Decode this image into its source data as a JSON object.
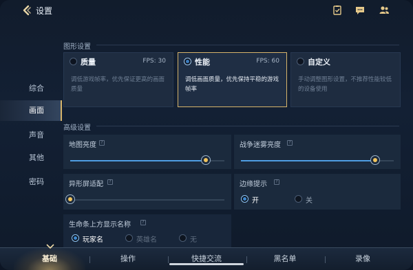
{
  "header": {
    "title": "设置"
  },
  "sections": {
    "graphics": "图形设置",
    "advanced": "高级设置"
  },
  "sidebar": {
    "items": [
      {
        "label": "综合"
      },
      {
        "label": "画面"
      },
      {
        "label": "声音"
      },
      {
        "label": "其他"
      },
      {
        "label": "密码"
      }
    ],
    "active": "画面"
  },
  "presets": [
    {
      "name": "质量",
      "fps": "FPS: 30",
      "desc": "调低游戏帧率，优先保证更高的画面质量",
      "selected": false
    },
    {
      "name": "性能",
      "fps": "FPS: 60",
      "desc": "调低画面质量，优先保持平稳的游戏帧率",
      "selected": true
    },
    {
      "name": "自定义",
      "fps": "",
      "desc": "手动调整图形设置，不推荐性能较低的设备使用",
      "selected": false
    }
  ],
  "advanced": {
    "map_brightness": {
      "label": "地图亮度",
      "value": 0.88
    },
    "fog_brightness": {
      "label": "战争迷雾亮度",
      "value": 0.88
    },
    "notch_adapt": {
      "label": "异形屏适配",
      "value": 0.0
    },
    "edge_hint": {
      "label": "边缘提示",
      "options": [
        "开",
        "关"
      ],
      "selected": "开"
    },
    "health_bar_name": {
      "label": "生命条上方显示名称",
      "options": [
        "玩家名",
        "英雄名",
        "无"
      ],
      "selected": "玩家名"
    }
  },
  "tabs": [
    {
      "label": "基础"
    },
    {
      "label": "操作"
    },
    {
      "label": "快捷交流"
    },
    {
      "label": "黑名单"
    },
    {
      "label": "录像"
    }
  ],
  "active_tab": "基础",
  "colors": {
    "accent_gold": "#d7b46a",
    "slider_fill": "#4f9ee3",
    "thumb_core": "#f1c45e"
  }
}
